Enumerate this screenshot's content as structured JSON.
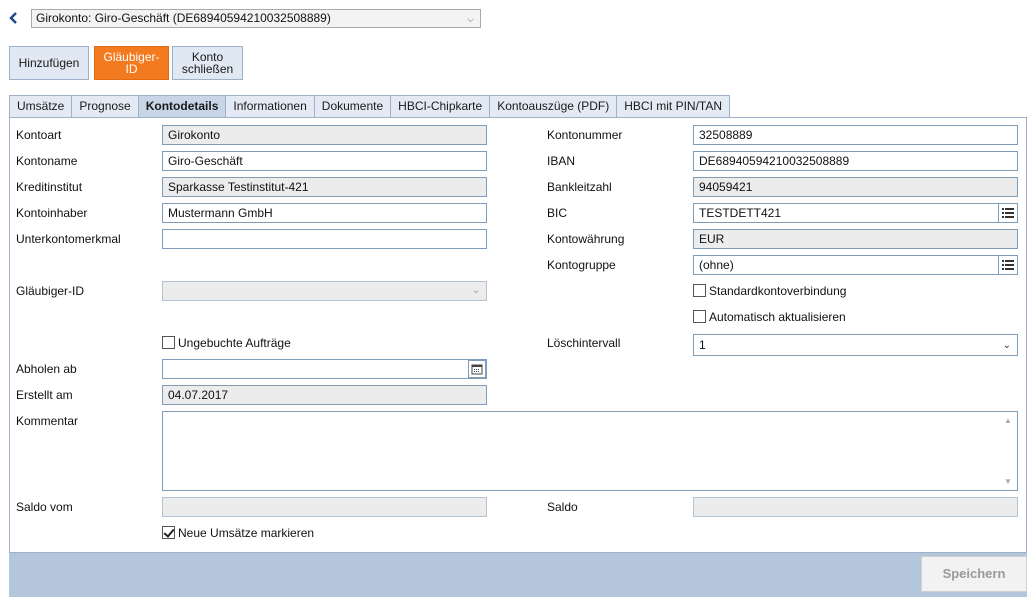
{
  "header": {
    "back_icon": "chevron-left-icon",
    "account_select": "Girokonto: Giro-Geschäft (DE68940594210032508889)"
  },
  "actions": {
    "add": "Hinzufügen",
    "creditor_id_line1": "Gläubiger-",
    "creditor_id_line2": "ID",
    "close_line1": "Konto",
    "close_line2": "schließen"
  },
  "tabs": [
    "Umsätze",
    "Prognose",
    "Kontodetails",
    "Informationen",
    "Dokumente",
    "HBCI-Chipkarte",
    "Kontoauszüge (PDF)",
    "HBCI mit PIN/TAN"
  ],
  "active_tab": "Kontodetails",
  "form": {
    "kontoart": {
      "label": "Kontoart",
      "value": "Girokonto"
    },
    "kontoname": {
      "label": "Kontoname",
      "value": "Giro-Geschäft"
    },
    "kreditinstitut": {
      "label": "Kreditinstitut",
      "value": "Sparkasse Testinstitut-421"
    },
    "kontoinhaber": {
      "label": "Kontoinhaber",
      "value": "Mustermann GmbH"
    },
    "unterkontomerkmal": {
      "label": "Unterkontomerkmal",
      "value": ""
    },
    "glaeubiger_id": {
      "label": "Gläubiger-ID",
      "value": ""
    },
    "ungebuchte": {
      "label": "Ungebuchte Aufträge",
      "checked": false
    },
    "abholen_ab": {
      "label": "Abholen ab",
      "value": ""
    },
    "erstellt_am": {
      "label": "Erstellt am",
      "value": "04.07.2017"
    },
    "kommentar": {
      "label": "Kommentar",
      "value": ""
    },
    "saldo_vom": {
      "label": "Saldo vom",
      "value": ""
    },
    "neue_umsaetze": {
      "label": "Neue Umsätze markieren",
      "checked": true
    },
    "kontonummer": {
      "label": "Kontonummer",
      "value": "32508889"
    },
    "iban": {
      "label": "IBAN",
      "value": "DE68940594210032508889"
    },
    "bankleitzahl": {
      "label": "Bankleitzahl",
      "value": "94059421"
    },
    "bic": {
      "label": "BIC",
      "value": "TESTDETT421"
    },
    "kontowaehrung": {
      "label": "Kontowährung",
      "value": "EUR"
    },
    "kontogruppe": {
      "label": "Kontogruppe",
      "value": "(ohne)"
    },
    "standardkonto": {
      "label": "Standardkontoverbindung",
      "checked": false
    },
    "auto_aktualisieren": {
      "label": "Automatisch aktualisieren",
      "checked": false
    },
    "loeschintervall": {
      "label": "Löschintervall",
      "value": "1"
    },
    "saldo": {
      "label": "Saldo",
      "value": ""
    }
  },
  "footer": {
    "save": "Speichern"
  },
  "colors": {
    "accent": "#f47a1f",
    "tab_bg": "#e3eaf3",
    "active_tab_bg": "#c7d5e6",
    "footer_bg": "#b4c6dc"
  }
}
